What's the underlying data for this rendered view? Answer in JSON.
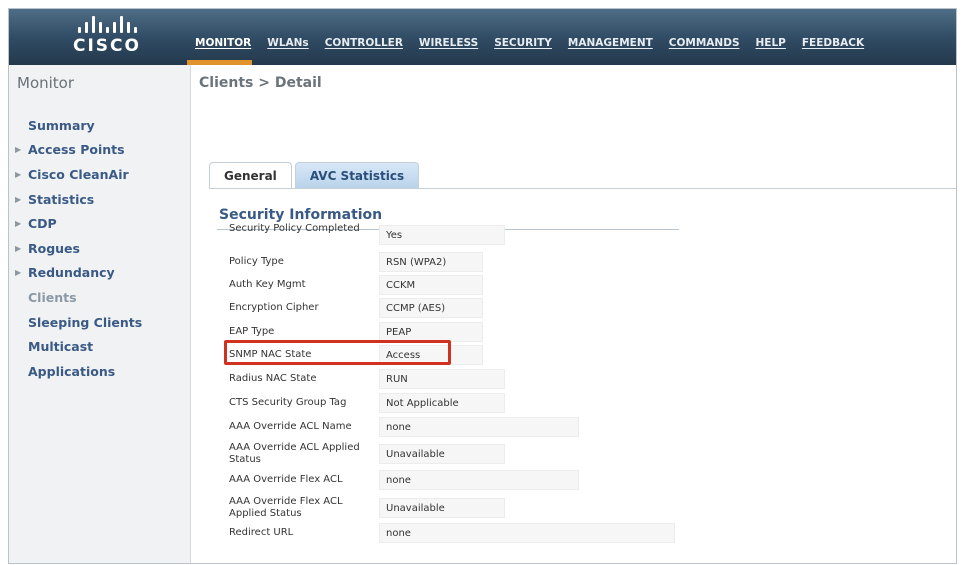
{
  "brand": {
    "logo_text": "CISCO"
  },
  "nav": {
    "items": [
      {
        "label": "MONITOR",
        "active": true
      },
      {
        "label": "WLANs",
        "active": false
      },
      {
        "label": "CONTROLLER",
        "active": false
      },
      {
        "label": "WIRELESS",
        "active": false
      },
      {
        "label": "SECURITY",
        "active": false
      },
      {
        "label": "MANAGEMENT",
        "active": false
      },
      {
        "label": "COMMANDS",
        "active": false
      },
      {
        "label": "HELP",
        "active": false
      },
      {
        "label": "FEEDBACK",
        "active": false
      }
    ],
    "accent_color": "#e0932a"
  },
  "sidebar": {
    "title": "Monitor",
    "items": [
      {
        "label": "Summary",
        "expandable": false
      },
      {
        "label": "Access Points",
        "expandable": true
      },
      {
        "label": "Cisco CleanAir",
        "expandable": true
      },
      {
        "label": "Statistics",
        "expandable": true
      },
      {
        "label": "CDP",
        "expandable": true
      },
      {
        "label": "Rogues",
        "expandable": true
      },
      {
        "label": "Redundancy",
        "expandable": true
      },
      {
        "label": "Clients",
        "expandable": false,
        "current": true
      },
      {
        "label": "Sleeping Clients",
        "expandable": false
      },
      {
        "label": "Multicast",
        "expandable": false
      },
      {
        "label": "Applications",
        "expandable": false
      }
    ],
    "arrow_icon": "triangle-right-icon"
  },
  "main": {
    "breadcrumb": "Clients > Detail",
    "tabs": [
      {
        "label": "General",
        "active": true
      },
      {
        "label": "AVC Statistics",
        "active": false
      }
    ],
    "section_title": "Security Information",
    "fields": [
      {
        "label": "Security Policy Completed",
        "value": "Yes"
      },
      {
        "label": "Policy Type",
        "value": "RSN (WPA2)"
      },
      {
        "label": "Auth Key Mgmt",
        "value": "CCKM"
      },
      {
        "label": "Encryption Cipher",
        "value": "CCMP (AES)"
      },
      {
        "label": "EAP Type",
        "value": "PEAP",
        "highlighted": true
      },
      {
        "label": "SNMP NAC State",
        "value": "Access"
      },
      {
        "label": "Radius NAC State",
        "value": "RUN"
      },
      {
        "label": "CTS Security Group Tag",
        "value": "Not Applicable"
      },
      {
        "label": "AAA Override ACL Name",
        "value": "none"
      },
      {
        "label": "AAA Override ACL Applied Status",
        "value": "Unavailable"
      },
      {
        "label": "AAA Override Flex ACL",
        "value": "none"
      },
      {
        "label": "AAA Override Flex ACL Applied Status",
        "value": "Unavailable"
      },
      {
        "label": "Redirect URL",
        "value": "none"
      }
    ],
    "highlight_color": "#d0321f"
  }
}
